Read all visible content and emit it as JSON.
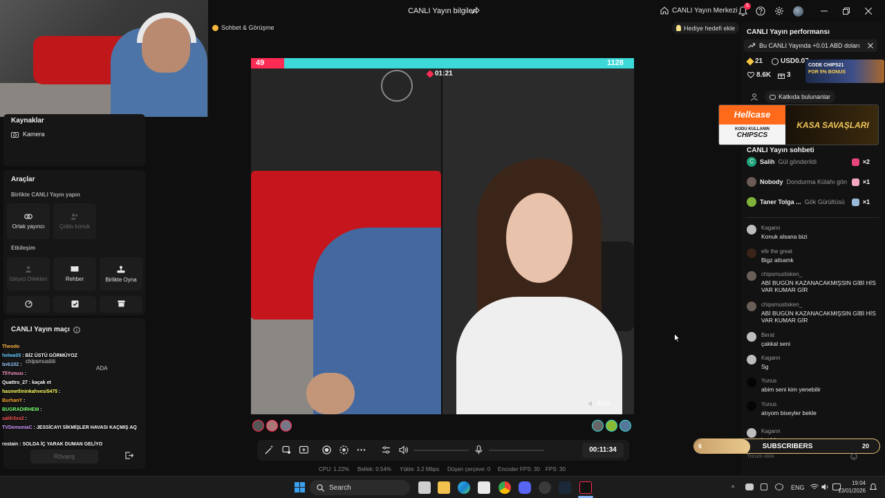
{
  "window": {
    "title": "CANLI Yayın bilgileri",
    "live_center": "CANLI Yayın Merkezi",
    "notification_count": "5"
  },
  "stream_header": {
    "chat_call_pill": "Sohbet & Görüşme",
    "gift_goal_pill": "Hediye hedefi ekle"
  },
  "left_panel": {
    "sources_title": "Kaynaklar",
    "source_camera": "Kamera",
    "tools_title": "Araçlar",
    "together_title": "Birlikte CANLI Yayın yapın",
    "co_host": "Ortak yayıncı",
    "multi_guest": "Çoklu konuk",
    "interaction_title": "Etkileşim",
    "viewer_requests": "İzleyici Dilekleri",
    "guide": "Rehber",
    "play_together": "Birlikte Oyna",
    "match_title": "CANLI Yayın maçı",
    "rematch": "Rövanş",
    "match_names": [
      "chipsmustiiii",
      "ADA"
    ]
  },
  "overlay_chat": [
    {
      "user": "Theodo",
      "text": ""
    },
    {
      "user": "helwa05",
      "text": ": BİZ ÜSTÜ GÖRMÜYOZ"
    },
    {
      "user": "bvb102",
      "text": ":"
    },
    {
      "user": "75Yunusı",
      "text": ":"
    },
    {
      "user": "Quattro_27",
      "text": ": kaçak et"
    },
    {
      "user": "hasmetlininkahvesi5475",
      "text": ":"
    },
    {
      "user": "BurhanY",
      "text": ":"
    },
    {
      "user": "BUGRADIRHEM",
      "text": ":"
    },
    {
      "user": "salih3xx2",
      "text": ":"
    },
    {
      "user": "TVDemoniaC",
      "text": ": JESSİCAYI SİKMİŞLER HAVASI KAÇMIŞ AQ"
    },
    {
      "user": "rostain",
      "text": ": SOLDA İÇ YARAK DUMAN GELİYO"
    }
  ],
  "battle": {
    "left_score": "49",
    "right_score": "1128",
    "timer": "01:21",
    "right_streamer": "ADA"
  },
  "controls": {
    "elapsed": "00:11:34"
  },
  "stats": {
    "cpu": "CPU:  1.22%",
    "memory": "Bellek:  0.54%",
    "upload": "Yükle:  3.2 Mbps",
    "dropped": "Düşen çerçeve:  0",
    "encoder_fps": "Encoder FPS:  30",
    "fps": "FPS:  30"
  },
  "right_panel": {
    "perf_title": "CANLI Yayın performansı",
    "earnings_banner": "Bu CANLI Yayında +0.01 ABD doları",
    "diamonds": "21",
    "usd": "USD0.07",
    "viewers": "8.6K",
    "gifters": "3",
    "contributors_label": "Katkıda bulunanlar",
    "chat_title": "CANLI Yayın sohbeti",
    "comment_placeholder": "Yorum ekle"
  },
  "gift_events": [
    {
      "user": "Salih",
      "action": "Gül gönderildi",
      "count": "×2",
      "avatar_color": "#1fa37a",
      "avatar_letter": "C",
      "gift_color": "#e8467a"
    },
    {
      "user": "Nobody",
      "action": "Dondurma Külahı gön",
      "count": "×1",
      "avatar_color": "#6b5a55",
      "avatar_letter": "",
      "gift_color": "#f2a7c3"
    },
    {
      "user": "Taner Tolga ...",
      "action": "Gök Gürültüsü",
      "count": "×1",
      "avatar_color": "#7fb23a",
      "avatar_letter": "",
      "gift_color": "#9ab8d8"
    }
  ],
  "chat_messages": [
    {
      "user": "Kagann",
      "text": "Konuk alsana bizi",
      "avatar_color": "#bdbdbd"
    },
    {
      "user": "efe the great",
      "text": "Bigz attıamk",
      "avatar_color": "#3a2418"
    },
    {
      "user": "chipsmustisken_",
      "text": "ABİ BUGÜN KAZANACAKMIŞSIN GİBİ HİS VAR KUMAR GİR",
      "avatar_color": "#6a5e58"
    },
    {
      "user": "chipsmustisken_",
      "text": "ABİ BUGÜN KAZANACAKMIŞSIN GİBİ HİS VAR KUMAR GİR",
      "avatar_color": "#6a5e58"
    },
    {
      "user": "Berat",
      "text": "çakkal seni",
      "avatar_color": "#bdbdbd"
    },
    {
      "user": "Kagann",
      "text": "Sg",
      "avatar_color": "#bdbdbd"
    },
    {
      "user": "Yunus",
      "text": "abim seni kim yenebilir",
      "avatar_color": "#050505"
    },
    {
      "user": "Yunus",
      "text": "atıyom biseyler bekle",
      "avatar_color": "#050505"
    },
    {
      "user": "Kagann",
      "text": "katıldı",
      "avatar_color": "#bdbdbd"
    }
  ],
  "ads": {
    "hellcase_brand": "Hellcase",
    "hellcase_code_label": "KODU KULLANIN",
    "hellcase_code": "CHIPSCS",
    "hellcase_slogan": "KASA SAVAŞLARI",
    "chips_code": "CODE CHIPS21",
    "chips_bonus": "FOR 5% BONUS"
  },
  "subscribers": {
    "label": "SUBSCRIBERS",
    "current": "6",
    "goal": "20",
    "fraction": 0.3
  },
  "taskbar": {
    "search": "Search",
    "lang": "ENG",
    "time": "19:04",
    "date": "13/01/2026"
  },
  "colors": {
    "accent_pink": "#fe2c55",
    "accent_cyan": "#3dd9d9",
    "gold": "#e7c178"
  }
}
